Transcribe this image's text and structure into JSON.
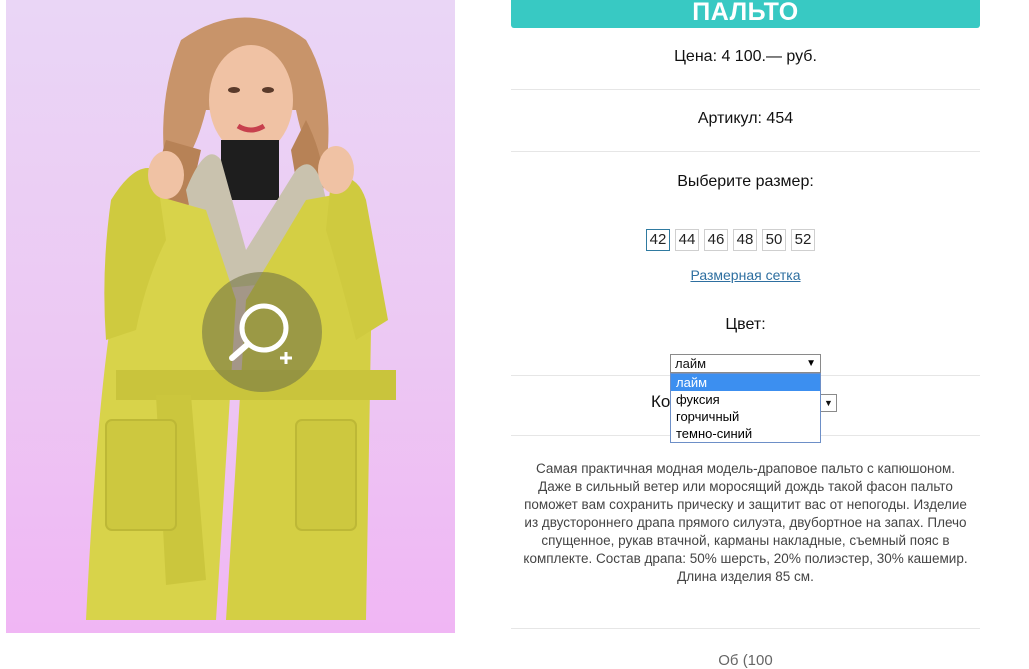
{
  "product": {
    "title": "ПАЛЬТО",
    "price": "Цена: 4 100.— руб.",
    "article": "Артикул: 454",
    "choose_size_label": "Выберите размер:",
    "sizes": [
      "42",
      "44",
      "46",
      "48",
      "50",
      "52"
    ],
    "selected_size": "42",
    "size_chart_link": "Размерная сетка",
    "color_label": "Цвет:",
    "color_select": {
      "value": "лайм",
      "options": [
        "лайм",
        "фуксия",
        "горчичный",
        "темно-синий"
      ]
    },
    "quantity_label_visible": "Ко",
    "description": "Самая практичная модная модель-драповое пальто с капюшоном. Даже в сильный ветер или моросящий дождь такой фасон пальто поможет вам сохранить прическу и защитит вас от непогоды. Изделие из двустороннего драпа прямого силуэта, двубортное на запах. Плечо спущенное, рукав втачной, карманы накладные, съемный пояс в комплекте. Состав драпа: 50% шерсть, 20% полиэстер, 30% кашемир. Длина изделия 85 см.",
    "footer_partial": "Об (100"
  },
  "icons": {
    "zoom": "zoom-in-magnifier-icon",
    "dropdown_arrow": "caret-down-icon"
  },
  "colors": {
    "accent": "#38c9c3",
    "link": "#2e6fa0",
    "dropdown_highlight": "#3c8ff0",
    "coat_lime": "#d8d34a",
    "photo_bg_top": "#ead6f6",
    "photo_bg_bottom": "#f0b6f4"
  }
}
